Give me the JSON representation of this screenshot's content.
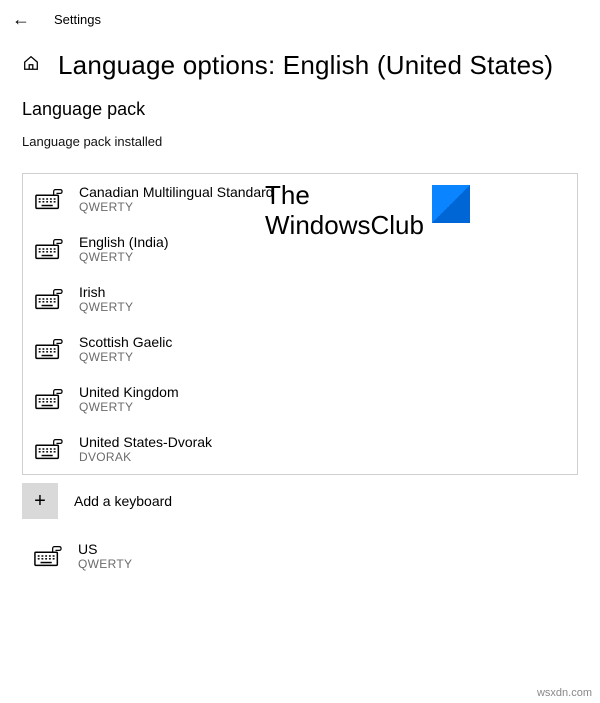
{
  "topbar": {
    "app_title": "Settings"
  },
  "heading": "Language options: English (United States)",
  "section": {
    "title": "Language pack",
    "status": "Language pack installed"
  },
  "watermark": {
    "line1": "The",
    "line2": "WindowsClub"
  },
  "keyboards": [
    {
      "name": "Canadian Multilingual Standard",
      "layout": "QWERTY"
    },
    {
      "name": "English (India)",
      "layout": "QWERTY"
    },
    {
      "name": "Irish",
      "layout": "QWERTY"
    },
    {
      "name": "Scottish Gaelic",
      "layout": "QWERTY"
    },
    {
      "name": "United Kingdom",
      "layout": "QWERTY"
    },
    {
      "name": "United States-Dvorak",
      "layout": "DVORAK"
    }
  ],
  "add_keyboard": {
    "label": "Add a keyboard",
    "plus": "+"
  },
  "extra_keyboard": {
    "name": "US",
    "layout": "QWERTY"
  },
  "attribution": "wsxdn.com"
}
